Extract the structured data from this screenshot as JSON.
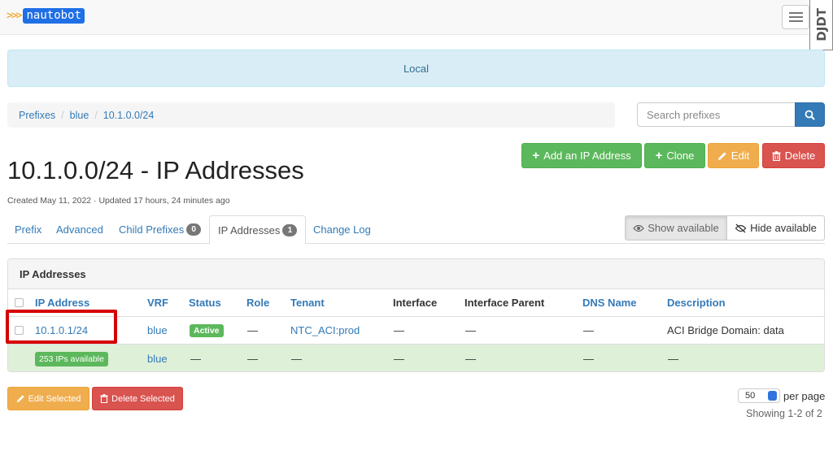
{
  "navbar": {
    "brand_arrows": ">>>",
    "brand_name": "nautobot",
    "debug_toolbar": "DJDT"
  },
  "banner": {
    "text": "Local"
  },
  "breadcrumb": [
    "Prefixes",
    "blue",
    "10.1.0.0/24"
  ],
  "search": {
    "placeholder": "Search prefixes"
  },
  "actions": {
    "add_ip": "Add an IP Address",
    "clone": "Clone",
    "edit": "Edit",
    "delete": "Delete"
  },
  "page": {
    "title": "10.1.0.0/24 - IP Addresses",
    "created": "Created May 11, 2022 · Updated 17 hours, 24 minutes ago"
  },
  "tabs": {
    "prefix": "Prefix",
    "advanced": "Advanced",
    "child_prefixes": "Child Prefixes",
    "child_prefixes_count": "0",
    "ip_addresses": "IP Addresses",
    "ip_addresses_count": "1",
    "change_log": "Change Log"
  },
  "availability": {
    "show": "Show available",
    "hide": "Hide available"
  },
  "panel": {
    "title": "IP Addresses",
    "columns": [
      "IP Address",
      "VRF",
      "Status",
      "Role",
      "Tenant",
      "Interface",
      "Interface Parent",
      "DNS Name",
      "Description"
    ],
    "rows": [
      {
        "ip": "10.1.0.1/24",
        "vrf": "blue",
        "status": "Active",
        "role": "—",
        "tenant": "NTC_ACI:prod",
        "interface": "—",
        "interface_parent": "—",
        "dns_name": "—",
        "description": "ACI Bridge Domain: data"
      }
    ],
    "available_row": {
      "label": "253 IPs available",
      "vrf": "blue",
      "status": "—",
      "role": "—",
      "tenant": "—",
      "interface": "—",
      "interface_parent": "—",
      "dns_name": "—",
      "description": "—"
    }
  },
  "bulk": {
    "edit": "Edit Selected",
    "delete": "Delete Selected"
  },
  "pagination": {
    "per_page_value": "50",
    "per_page_label": "per page",
    "showing": "Showing 1-2 of 2"
  },
  "colors": {
    "primary": "#337ab7",
    "success": "#5cb85c",
    "warning": "#f0ad4e",
    "danger": "#d9534f",
    "info_bg": "#d9edf7",
    "highlight": "#d60000"
  }
}
